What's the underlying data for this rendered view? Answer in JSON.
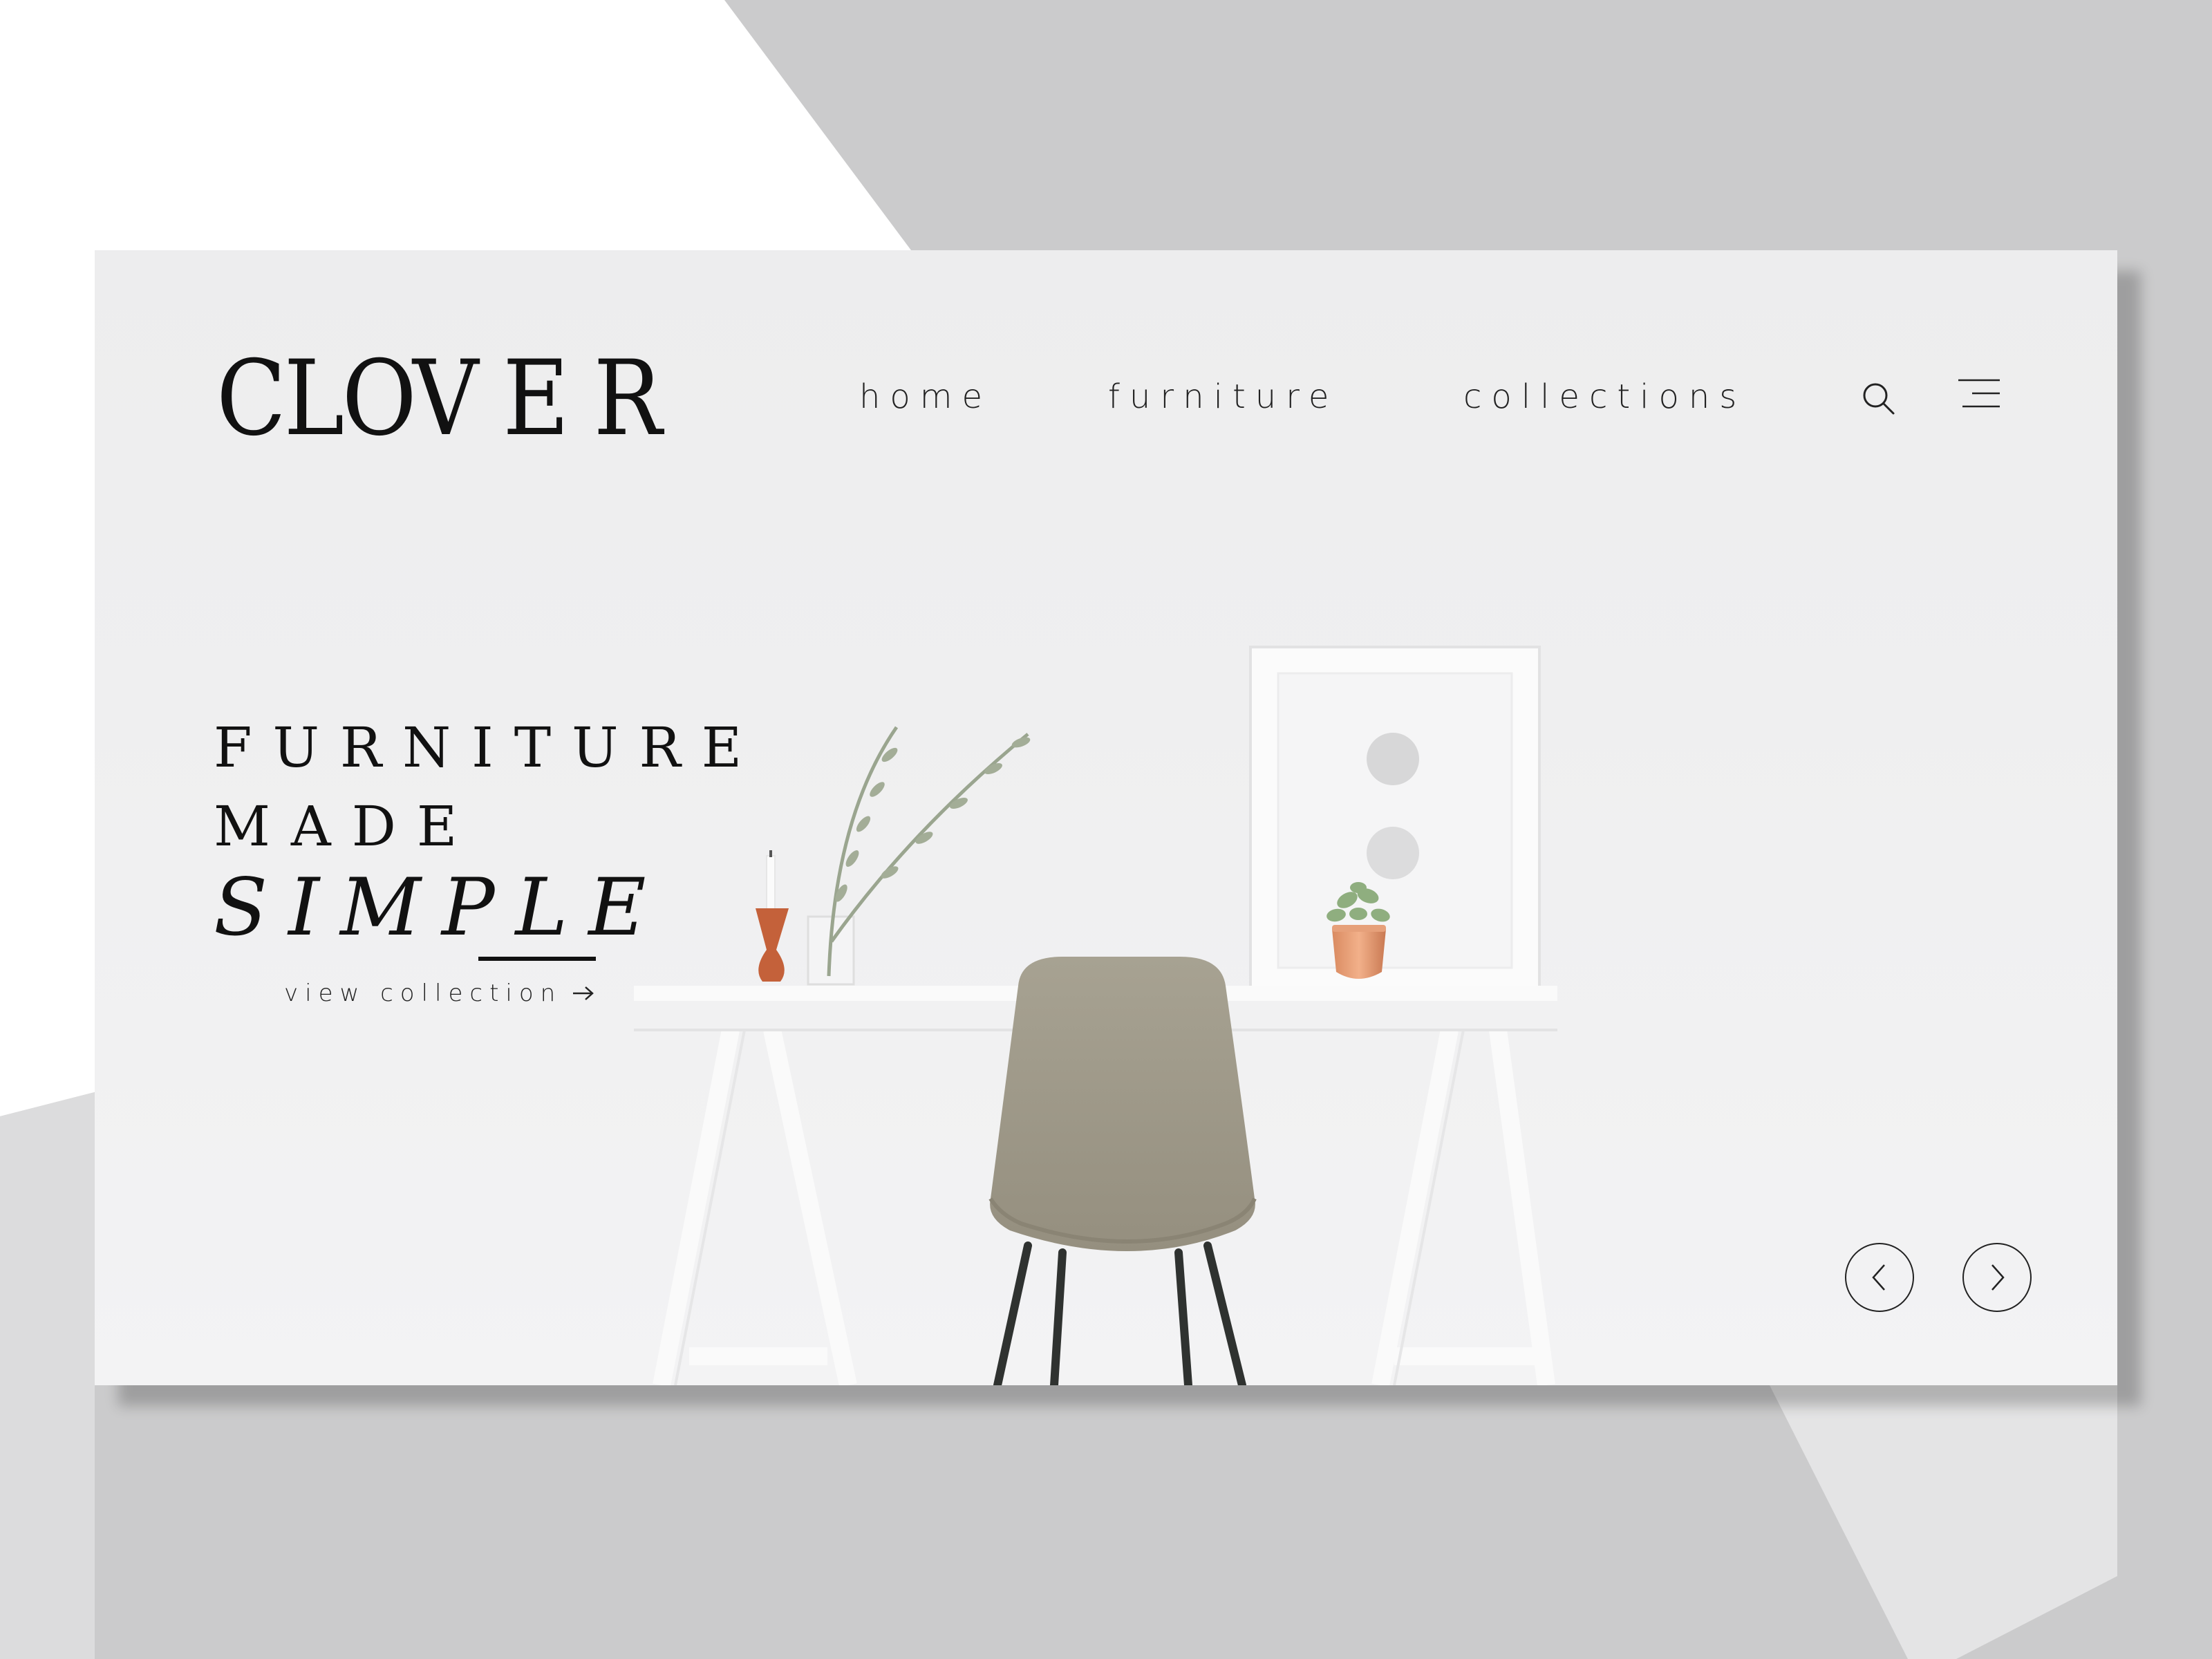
{
  "brand": {
    "logo_text": "CLOV E R"
  },
  "nav": {
    "items": [
      {
        "label": "home"
      },
      {
        "label": "furniture"
      },
      {
        "label": "collections"
      }
    ],
    "search_icon": "search-icon",
    "menu_icon": "hamburger-menu-icon"
  },
  "hero": {
    "headline_line1": "FURNITURE",
    "headline_line2": "MADE",
    "headline_line3": "SIMPLE",
    "cta_label": "view collection",
    "cta_icon": "arrow-right-icon"
  },
  "carousel": {
    "prev_icon": "chevron-left-icon",
    "next_icon": "chevron-right-icon"
  },
  "colors": {
    "page_background": "#cbcbcc",
    "card_background": "#efeff0",
    "text": "#111111",
    "chair": "#a19c8c",
    "wood": "#c4613a",
    "copper": "#e0946a"
  }
}
